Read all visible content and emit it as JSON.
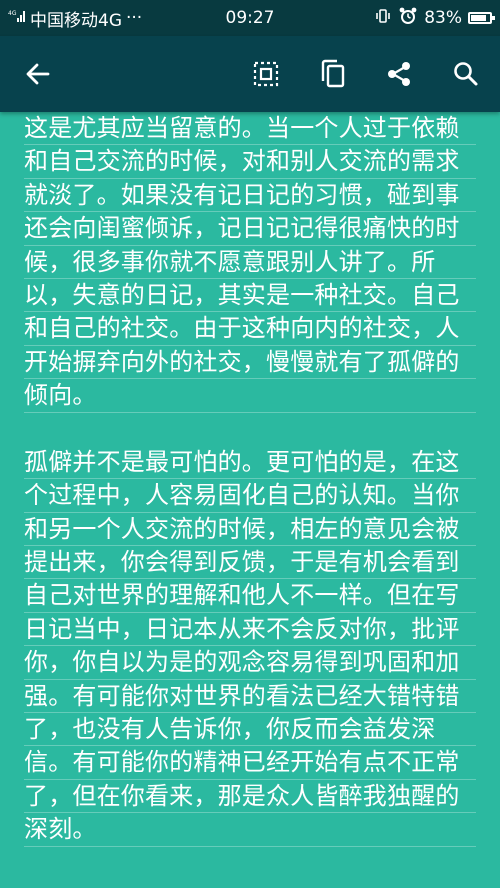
{
  "status_bar": {
    "carrier": "中国移动4G",
    "dots": "···",
    "time": "09:27",
    "battery_percent": "83%",
    "battery_level": 0.83
  },
  "toolbar": {
    "back_icon": "arrow-left-icon",
    "select_icon": "select-all-icon",
    "copy_icon": "copy-icon",
    "share_icon": "share-icon",
    "search_icon": "search-icon"
  },
  "colors": {
    "background": "#2bb9a0",
    "toolbar": "#07424d",
    "status_bar": "#083a40",
    "text": "#ffffff"
  },
  "article": {
    "paragraph1": [
      "这是尤其应当留意的。当一个人过于依赖",
      "和自己交流的时候，对和别人交流的需求",
      "就淡了。如果没有记日记的习惯，碰到事",
      "还会向闺蜜倾诉，记日记记得很痛快的时",
      "候，很多事你就不愿意跟别人讲了。所",
      "以，失意的日记，其实是一种社交。自己",
      "和自己的社交。由于这种向内的社交，人",
      "开始摒弃向外的社交，慢慢就有了孤僻的",
      "倾向。"
    ],
    "paragraph2": [
      "孤僻并不是最可怕的。更可怕的是，在这",
      "个过程中，人容易固化自己的认知。当你",
      "和另一个人交流的时候，相左的意见会被",
      "提出来，你会得到反馈，于是有机会看到",
      "自己对世界的理解和他人不一样。但在写",
      "日记当中，日记本从来不会反对你，批评",
      "你，你自以为是的观念容易得到巩固和加",
      "强。有可能你对世界的看法已经大错特错",
      "了，也没有人告诉你，你反而会益发深",
      "信。有可能你的精神已经开始有点不正常",
      "了，但在你看来，那是众人皆醉我独醒的",
      "深刻。"
    ]
  }
}
